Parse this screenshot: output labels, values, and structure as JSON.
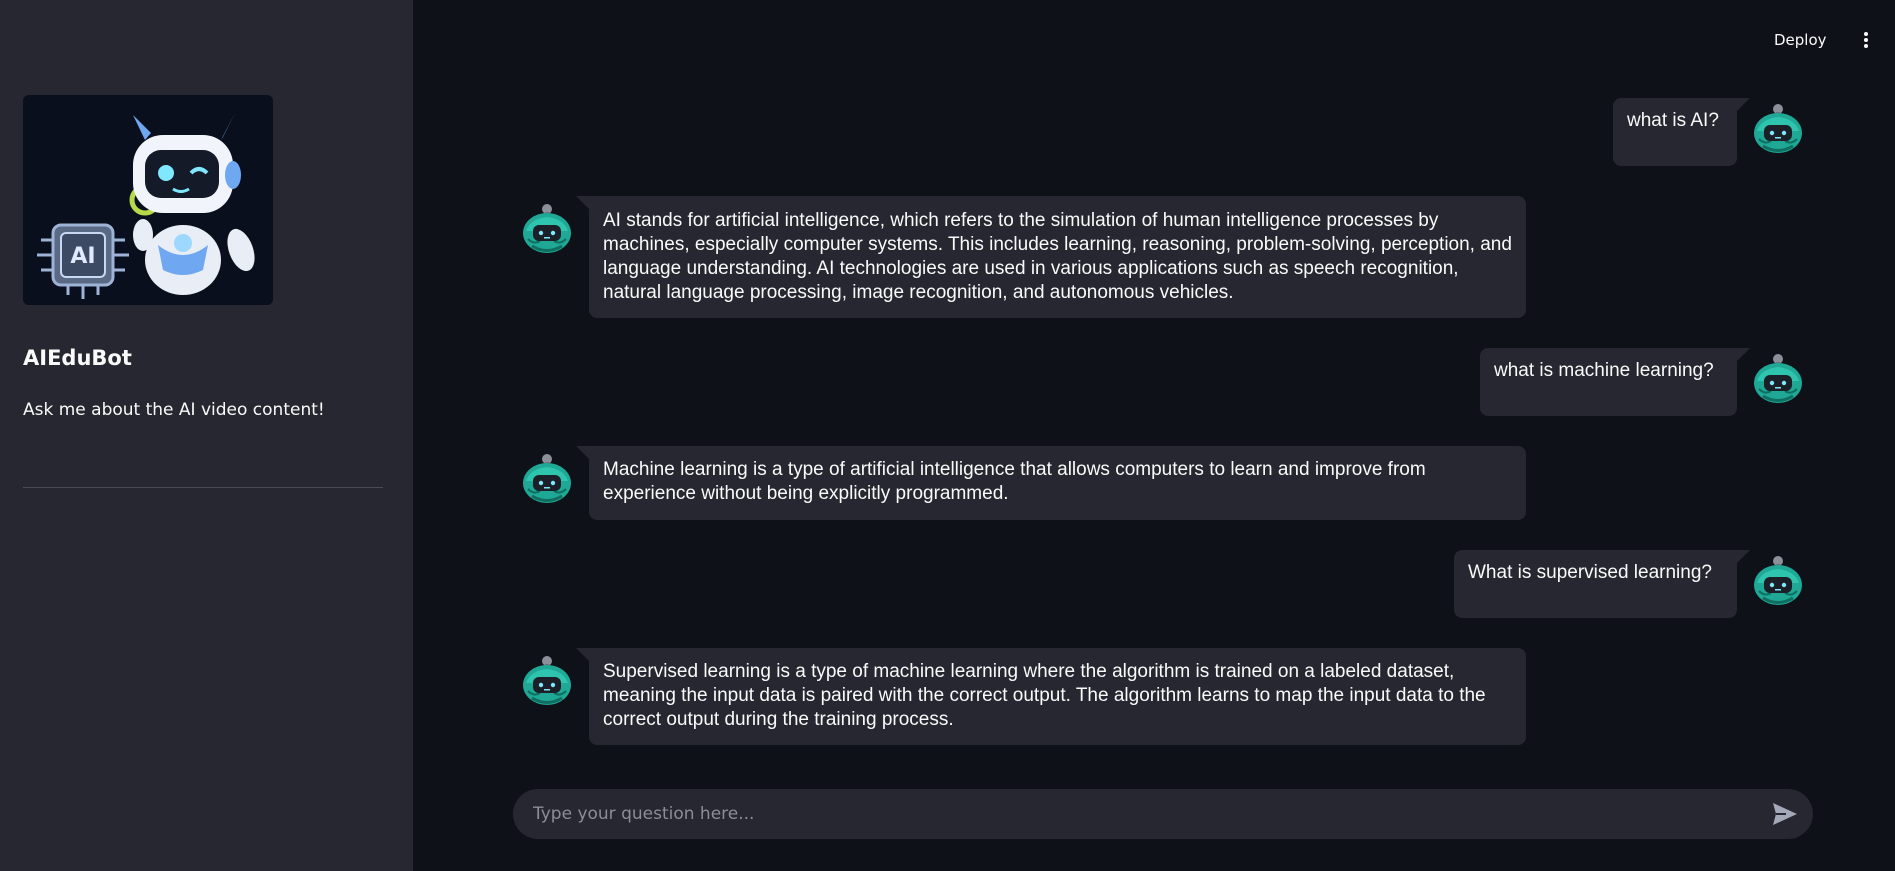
{
  "sidebar": {
    "title": "AIEduBot",
    "subtitle": "Ask me about the AI video content!",
    "logo_icon": "robot-ai-illustration",
    "logo_text": "AI"
  },
  "header": {
    "deploy_label": "Deploy",
    "menu_icon": "vertical-ellipsis-icon"
  },
  "messages": [
    {
      "role": "user",
      "text": "what is AI?"
    },
    {
      "role": "assistant",
      "text": "AI stands for artificial intelligence, which refers to the simulation of human intelligence processes by machines, especially computer systems. This includes learning, reasoning, problem-solving, perception, and language understanding. AI technologies are used in various applications such as speech recognition, natural language processing, image recognition, and autonomous vehicles."
    },
    {
      "role": "user",
      "text": "what is machine learning?"
    },
    {
      "role": "assistant",
      "text": "Machine learning is a type of artificial intelligence that allows computers to learn and improve from experience without being explicitly programmed."
    },
    {
      "role": "user",
      "text": "What is supervised learning?"
    },
    {
      "role": "assistant",
      "text": "Supervised learning is a type of machine learning where the algorithm is trained on a labeled dataset, meaning the input data is paired with the correct output. The algorithm learns to map the input data to the correct output during the training process."
    }
  ],
  "chat_input": {
    "placeholder": "Type your question here...",
    "value": "",
    "send_icon": "send-arrow-icon"
  },
  "colors": {
    "background": "#0e1117",
    "sidebar": "#262730",
    "bubble": "#262730",
    "avatar_teal": "#1fa896",
    "text": "#fafafa"
  }
}
